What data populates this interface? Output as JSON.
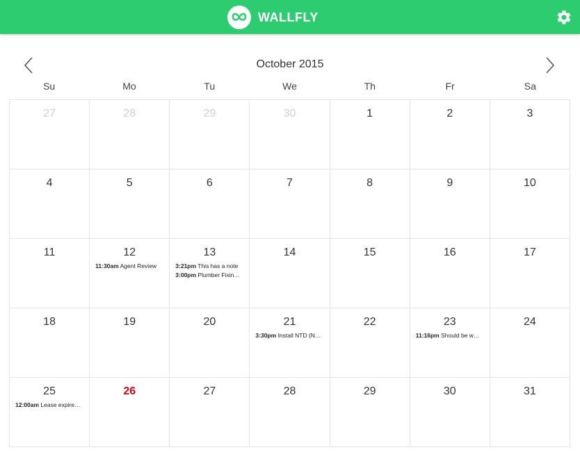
{
  "app": {
    "name": "WALLFLY",
    "colors": {
      "brand": "#2ecc71",
      "today": "#d0021b",
      "muted": "#cfcfcf"
    },
    "icons": {
      "logo": "wallfly-logo-icon",
      "settings": "gear-icon",
      "prev": "chevron-left-icon",
      "next": "chevron-right-icon"
    }
  },
  "calendar": {
    "month_title": "October 2015",
    "weekdays": [
      "Su",
      "Mo",
      "Tu",
      "We",
      "Th",
      "Fr",
      "Sa"
    ],
    "weeks": [
      [
        {
          "day": "27",
          "muted": true,
          "events": []
        },
        {
          "day": "28",
          "muted": true,
          "events": []
        },
        {
          "day": "29",
          "muted": true,
          "events": []
        },
        {
          "day": "30",
          "muted": true,
          "events": []
        },
        {
          "day": "1",
          "events": []
        },
        {
          "day": "2",
          "events": []
        },
        {
          "day": "3",
          "events": []
        }
      ],
      [
        {
          "day": "4",
          "events": []
        },
        {
          "day": "5",
          "events": []
        },
        {
          "day": "6",
          "events": []
        },
        {
          "day": "7",
          "events": []
        },
        {
          "day": "8",
          "events": []
        },
        {
          "day": "9",
          "events": []
        },
        {
          "day": "10",
          "events": []
        }
      ],
      [
        {
          "day": "11",
          "events": []
        },
        {
          "day": "12",
          "events": [
            {
              "time": "11:30am",
              "title": "Agent Review"
            }
          ]
        },
        {
          "day": "13",
          "events": [
            {
              "time": "3:21pm",
              "title": "This has a note"
            },
            {
              "time": "3:00pm",
              "title": "Plumber Fixin…"
            }
          ]
        },
        {
          "day": "14",
          "events": []
        },
        {
          "day": "15",
          "events": []
        },
        {
          "day": "16",
          "events": []
        },
        {
          "day": "17",
          "events": []
        }
      ],
      [
        {
          "day": "18",
          "events": []
        },
        {
          "day": "19",
          "events": []
        },
        {
          "day": "20",
          "events": []
        },
        {
          "day": "21",
          "events": [
            {
              "time": "3:30pm",
              "title": "Install NTD (N…"
            }
          ]
        },
        {
          "day": "22",
          "events": []
        },
        {
          "day": "23",
          "events": [
            {
              "time": "11:16pm",
              "title": "Should be w…"
            }
          ]
        },
        {
          "day": "24",
          "events": []
        }
      ],
      [
        {
          "day": "25",
          "events": [
            {
              "time": "12:00am",
              "title": "Lease expire…"
            }
          ]
        },
        {
          "day": "26",
          "today": true,
          "events": []
        },
        {
          "day": "27",
          "events": []
        },
        {
          "day": "28",
          "events": []
        },
        {
          "day": "29",
          "events": []
        },
        {
          "day": "30",
          "events": []
        },
        {
          "day": "31",
          "events": []
        }
      ]
    ]
  }
}
